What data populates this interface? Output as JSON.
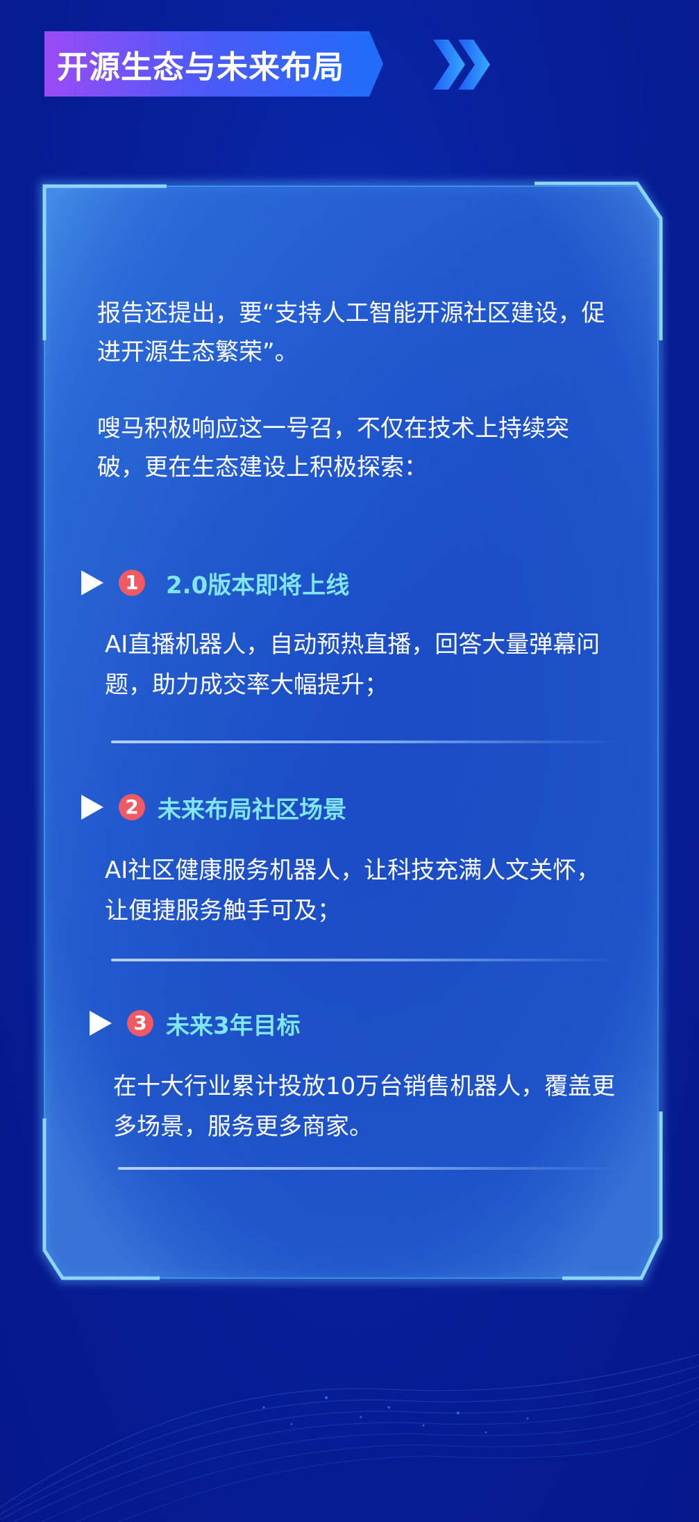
{
  "title": "开源生态与未来布局",
  "paragraphs": [
    "报告还提出，要“支持人工智能开源社区建设，促进开源生态繁荣”。",
    "嗖马积极响应这一号召，不仅在技术上持续突破，更在生态建设上积极探索："
  ],
  "items": [
    {
      "number": "1",
      "title": "2.0版本即将上线",
      "description": "AI直播机器人，自动预热直播，回答大量弹幕问题，助力成交率大幅提升；"
    },
    {
      "number": "2",
      "title": "未来布局社区场景",
      "description": "AI社区健康服务机器人，让科技充满人文关怀，让便捷服务触手可及；"
    },
    {
      "number": "3",
      "title": "未来3年目标",
      "description": "在十大行业累计投放10万台销售机器人，覆盖更多场景，服务更多商家。"
    }
  ],
  "colors": {
    "background": "#071f99",
    "accent_title": "#7fe6f2",
    "badge": "#f15a62",
    "panel_border": "#4fb6ff"
  },
  "icons": {
    "header": "double-chevron-right-icon",
    "bullet": "play-triangle-icon"
  }
}
